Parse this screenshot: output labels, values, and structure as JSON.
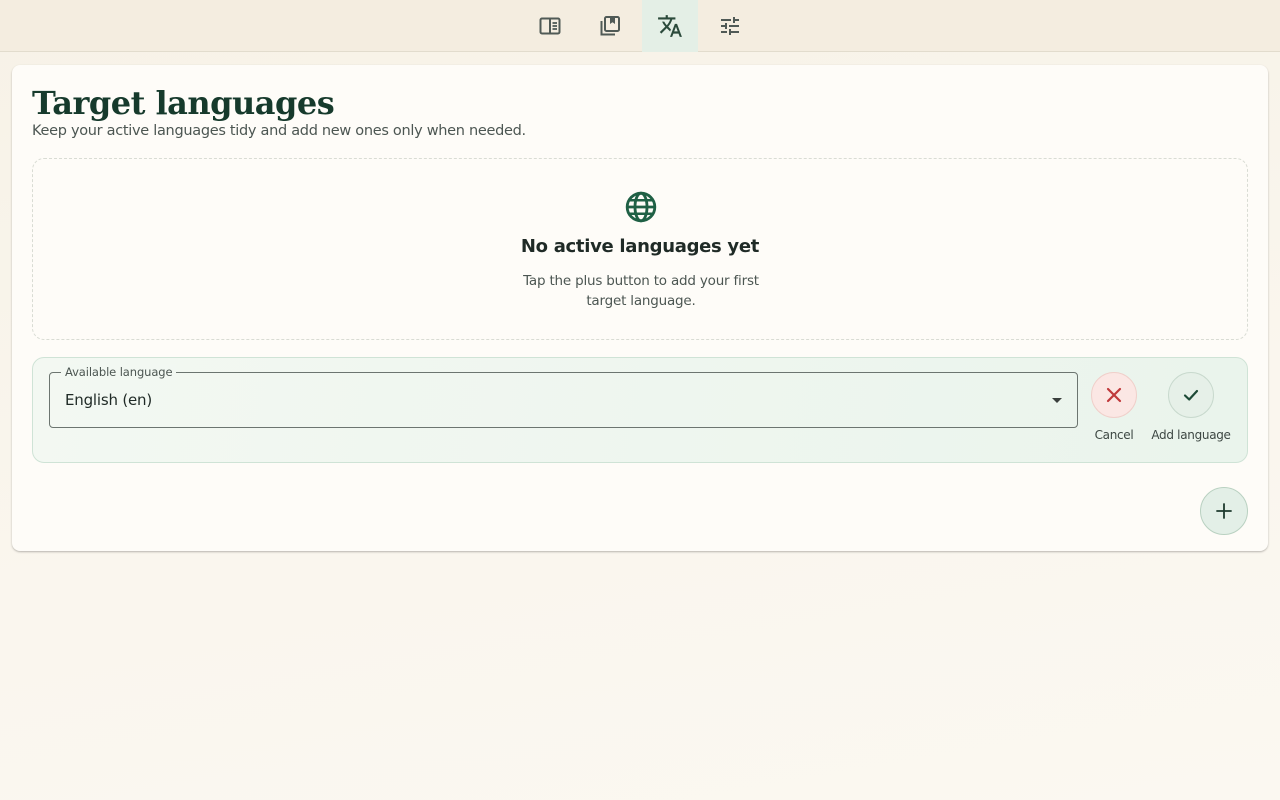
{
  "nav": {
    "tabs": [
      {
        "icon": "reader-icon",
        "active": false
      },
      {
        "icon": "library-icon",
        "active": false
      },
      {
        "icon": "translate-icon",
        "active": true
      },
      {
        "icon": "settings-sliders-icon",
        "active": false
      }
    ]
  },
  "page": {
    "title": "Target languages",
    "subtitle": "Keep your active languages tidy and add new ones only when needed."
  },
  "empty_state": {
    "icon": "globe-icon",
    "title": "No active languages yet",
    "description": "Tap the plus button to add your first target language."
  },
  "add_form": {
    "field_label": "Available language",
    "selected_value": "English (en)",
    "cancel_label": "Cancel",
    "confirm_label": "Add language",
    "cancel_icon": "close-icon",
    "confirm_icon": "check-icon"
  },
  "fab": {
    "icon": "plus-icon"
  },
  "colors": {
    "accent": "#1f6045",
    "title": "#163a2c",
    "danger": "#c0393b",
    "active_tab_bg": "#e4efe6"
  }
}
